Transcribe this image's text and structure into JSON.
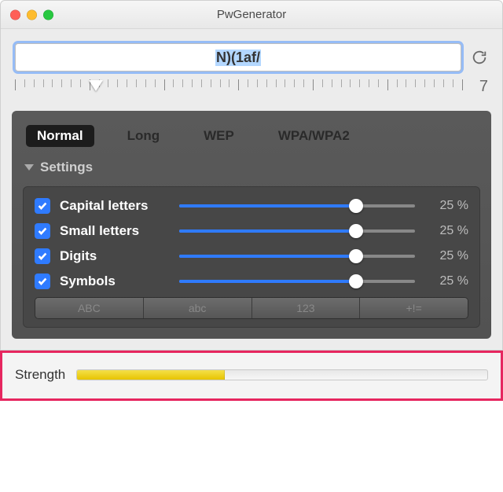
{
  "window": {
    "title": "PwGenerator"
  },
  "password": {
    "value": "N)(1af/",
    "selected": true
  },
  "length": {
    "value": "7",
    "min": 1,
    "max": 64,
    "percent": 18
  },
  "tabs": [
    {
      "label": "Normal",
      "active": true
    },
    {
      "label": "Long",
      "active": false
    },
    {
      "label": "WEP",
      "active": false
    },
    {
      "label": "WPA/WPA2",
      "active": false
    }
  ],
  "settings_label": "Settings",
  "options": [
    {
      "label": "Capital letters",
      "checked": true,
      "percent": 75,
      "display": "25 %"
    },
    {
      "label": "Small letters",
      "checked": true,
      "percent": 75,
      "display": "25 %"
    },
    {
      "label": "Digits",
      "checked": true,
      "percent": 75,
      "display": "25 %"
    },
    {
      "label": "Symbols",
      "checked": true,
      "percent": 75,
      "display": "25 %"
    }
  ],
  "segments": [
    {
      "label": "ABC"
    },
    {
      "label": "abc"
    },
    {
      "label": "123"
    },
    {
      "label": "+!="
    }
  ],
  "strength": {
    "label": "Strength",
    "percent": 36
  }
}
